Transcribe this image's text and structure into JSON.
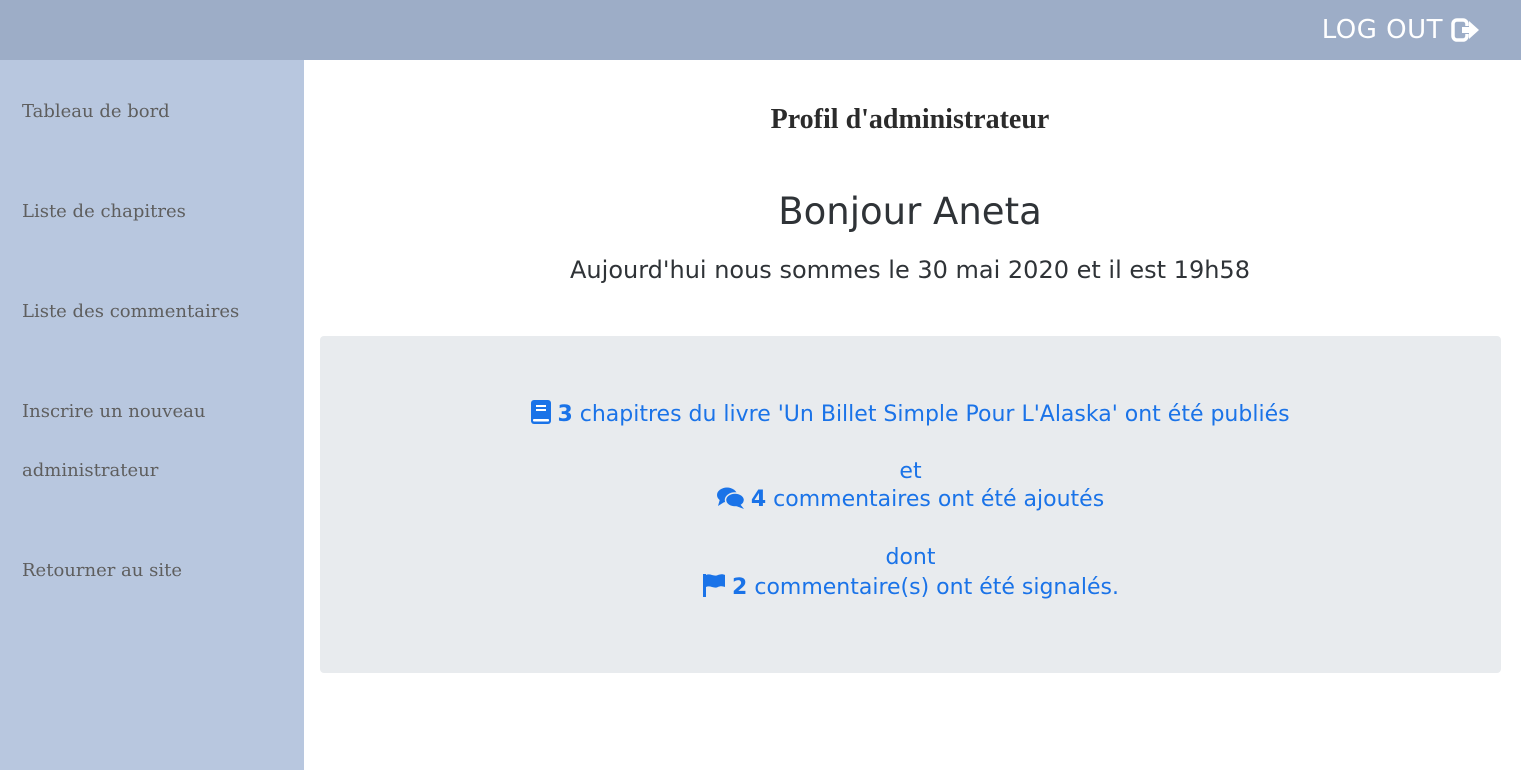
{
  "header": {
    "logout_label": "LOG OUT",
    "logout_icon": "sign-out-icon",
    "background": "#9dadc7"
  },
  "sidebar": {
    "background": "#b8c7df",
    "items": [
      {
        "label": "Tableau de bord"
      },
      {
        "label": "Liste de chapitres"
      },
      {
        "label": "Liste des commentaires"
      },
      {
        "label_line1": "Inscrire un nouveau",
        "label_line2": "administrateur"
      },
      {
        "label": "Retourner au site"
      }
    ]
  },
  "main": {
    "title": "Profil d'administrateur",
    "greeting": "Bonjour Aneta",
    "date_line": "Aujourd'hui nous sommes le 30 mai 2020 et il est 19h58",
    "stats": {
      "accent": "#1a73e8",
      "chapters": {
        "icon": "book-icon",
        "count": "3",
        "text": "chapitres du livre 'Un Billet Simple Pour L'Alaska' ont été publiés"
      },
      "connector_1": "et",
      "comments": {
        "icon": "comments-icon",
        "count": "4",
        "text": "commentaires ont été ajoutés"
      },
      "connector_2": "dont",
      "reported": {
        "icon": "flag-icon",
        "count": "2",
        "text": "commentaire(s) ont été signalés."
      }
    }
  }
}
